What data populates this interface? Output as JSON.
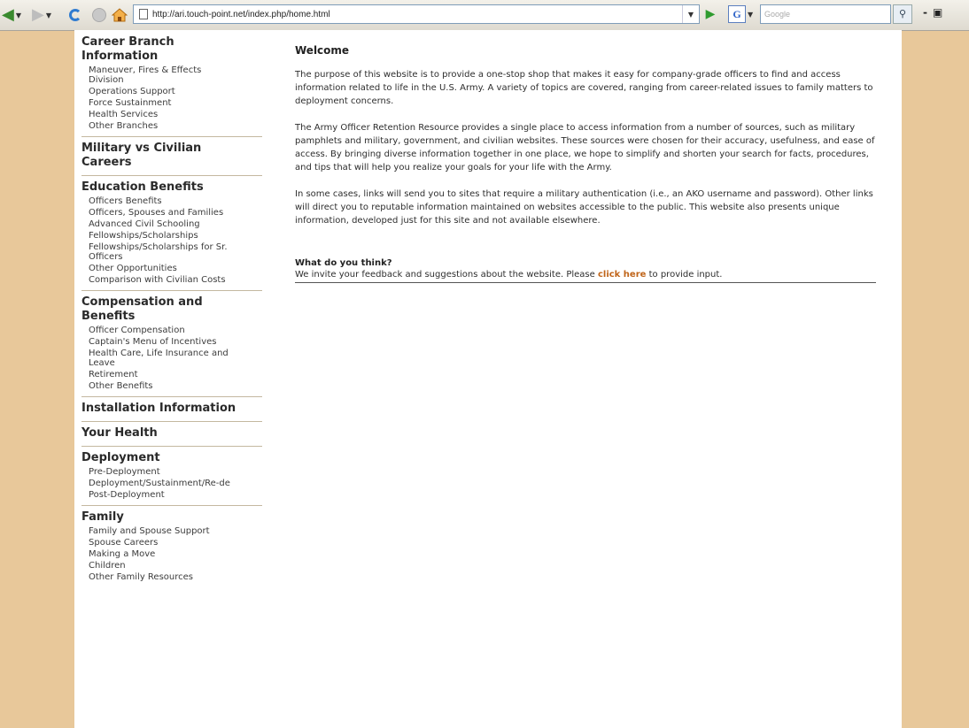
{
  "browser": {
    "url": "http://ari.touch-point.net/index.php/home.html",
    "search_placeholder": "Google"
  },
  "sidebar": {
    "sections": [
      {
        "title": "Career Branch Information",
        "items": [
          "Maneuver, Fires & Effects Division",
          "Operations Support",
          "Force Sustainment",
          "Health Services",
          "Other Branches"
        ]
      },
      {
        "title": "Military vs Civilian Careers",
        "items": []
      },
      {
        "title": "Education Benefits",
        "items": [
          "Officers Benefits",
          "Officers, Spouses and Families",
          "Advanced Civil Schooling",
          "Fellowships/Scholarships",
          "Fellowships/Scholarships for Sr. Officers",
          "Other Opportunities",
          "Comparison with Civilian Costs"
        ]
      },
      {
        "title": "Compensation and Benefits",
        "items": [
          "Officer Compensation",
          "Captain's Menu of Incentives",
          "Health Care, Life Insurance and Leave",
          "Retirement",
          "Other Benefits"
        ]
      },
      {
        "title": "Installation Information",
        "items": []
      },
      {
        "title": "Your Health",
        "items": []
      },
      {
        "title": "Deployment",
        "items": [
          "Pre-Deployment",
          "Deployment/Sustainment/Re-de",
          "Post-Deployment"
        ]
      },
      {
        "title": "Family",
        "items": [
          "Family and Spouse Support",
          "Spouse Careers",
          "Making a Move",
          "Children",
          "Other Family Resources"
        ]
      }
    ]
  },
  "main": {
    "heading": "Welcome",
    "paragraphs": [
      "The purpose of this website is to provide a one-stop shop that makes it easy for company-grade officers to find and access information related to life in the U.S. Army. A variety of topics are covered, ranging from career-related issues to family matters to deployment concerns.",
      "The Army Officer Retention Resource provides a single place to access information from a number of sources, such as military pamphlets and military, government, and civilian websites. These sources were chosen for their accuracy, usefulness, and ease of access. By bringing diverse information together in one place, we hope to simplify and shorten your search for facts, procedures, and tips that will help you realize your goals for your life with the Army.",
      "In some cases, links will send you to sites that require a military authentication (i.e., an AKO username and password). Other links will direct you to reputable information maintained on websites accessible to the public. This website also presents unique information, developed just for this site and not available elsewhere."
    ],
    "feedback": {
      "title": "What do you think?",
      "before": "We invite your feedback and suggestions about the website. Please ",
      "link": "click here",
      "after": " to provide input."
    }
  },
  "colors": {
    "frame_bg": "#e8c89a",
    "link": "#c0651a"
  }
}
